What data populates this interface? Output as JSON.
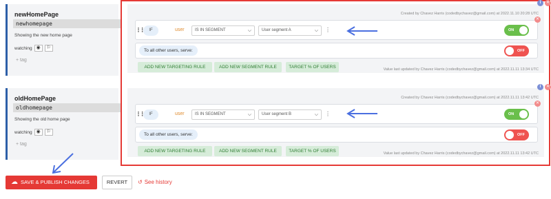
{
  "flags": [
    {
      "name": "newHomePage",
      "key": "newhomepage",
      "description": "Showing the new home page",
      "watching_label": "watching",
      "tag_add": "+ tag",
      "created": "Created by Chavez Harris (codedbychavez@gmail.com) at 2022.11.10 20:28 UTC",
      "rule": {
        "if_label": "IF",
        "attribute": "user",
        "operator": "IS IN SEGMENT",
        "value": "User segment A",
        "toggle": "ON"
      },
      "serve_label": "To all other users, serve:",
      "serve_toggle": "OFF",
      "actions": [
        "ADD NEW TARGETING RULE",
        "ADD NEW SEGMENT RULE",
        "TARGET % OF USERS"
      ],
      "updated": "Value last updated by Chavez Harris (codedbychavez@gmail.com) at 2022.11.11 13:34 UTC"
    },
    {
      "name": "oldHomePage",
      "key": "oldhomepage",
      "description": "Showing the old home page",
      "watching_label": "watching",
      "tag_add": "+ tag",
      "created": "Created by Chavez Harris (codedbychavez@gmail.com) at 2022.11.11 13:42 UTC",
      "rule": {
        "if_label": "IF",
        "attribute": "user",
        "operator": "IS IN SEGMENT",
        "value": "User segment B",
        "toggle": "ON"
      },
      "serve_label": "To all other users, serve:",
      "serve_toggle": "OFF",
      "actions": [
        "ADD NEW TARGETING RULE",
        "ADD NEW SEGMENT RULE",
        "TARGET % OF USERS"
      ],
      "updated": "Value last updated by Chavez Harris (codedbychavez@gmail.com) at 2022.11.11 13:42 UTC"
    }
  ],
  "bottom": {
    "publish": "SAVE & PUBLISH CHANGES",
    "revert": "REVERT",
    "history": "See history"
  },
  "colors": {
    "accent_red": "#e53935",
    "toggle_on": "#6abf4b",
    "toggle_off": "#ef5350",
    "annotation_arrow": "#4a6fe0",
    "flag_border": "#2d5fa8"
  },
  "icons": {
    "drag": "drag-handle-icon",
    "eye_off": "eye-off-icon",
    "flag": "flag-icon",
    "info": "info-icon",
    "close": "close-icon",
    "chevron": "chevron-down-icon",
    "kebab": "kebab-icon",
    "cloud_upload": "cloud-upload-icon",
    "history": "history-icon"
  }
}
